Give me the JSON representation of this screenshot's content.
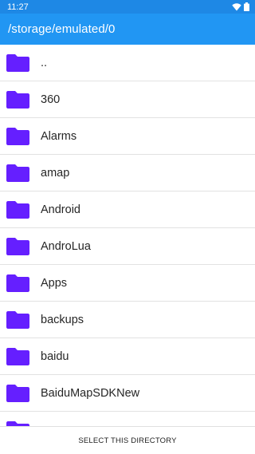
{
  "status_bar": {
    "time": "11:27",
    "icons": [
      "wifi-icon",
      "battery-icon"
    ],
    "color": "#1e88e5"
  },
  "app_bar": {
    "title": "/storage/emulated/0",
    "color": "#2196f3"
  },
  "folder_icon_color": "#651fff",
  "files": [
    {
      "name": ".."
    },
    {
      "name": "360"
    },
    {
      "name": "Alarms"
    },
    {
      "name": "amap"
    },
    {
      "name": "Android"
    },
    {
      "name": "AndroLua"
    },
    {
      "name": "Apps"
    },
    {
      "name": "backups"
    },
    {
      "name": "baidu"
    },
    {
      "name": "BaiduMapSDKNew"
    },
    {
      "name": ""
    }
  ],
  "bottom_bar": {
    "select_label": "SELECT THIS DIRECTORY"
  }
}
